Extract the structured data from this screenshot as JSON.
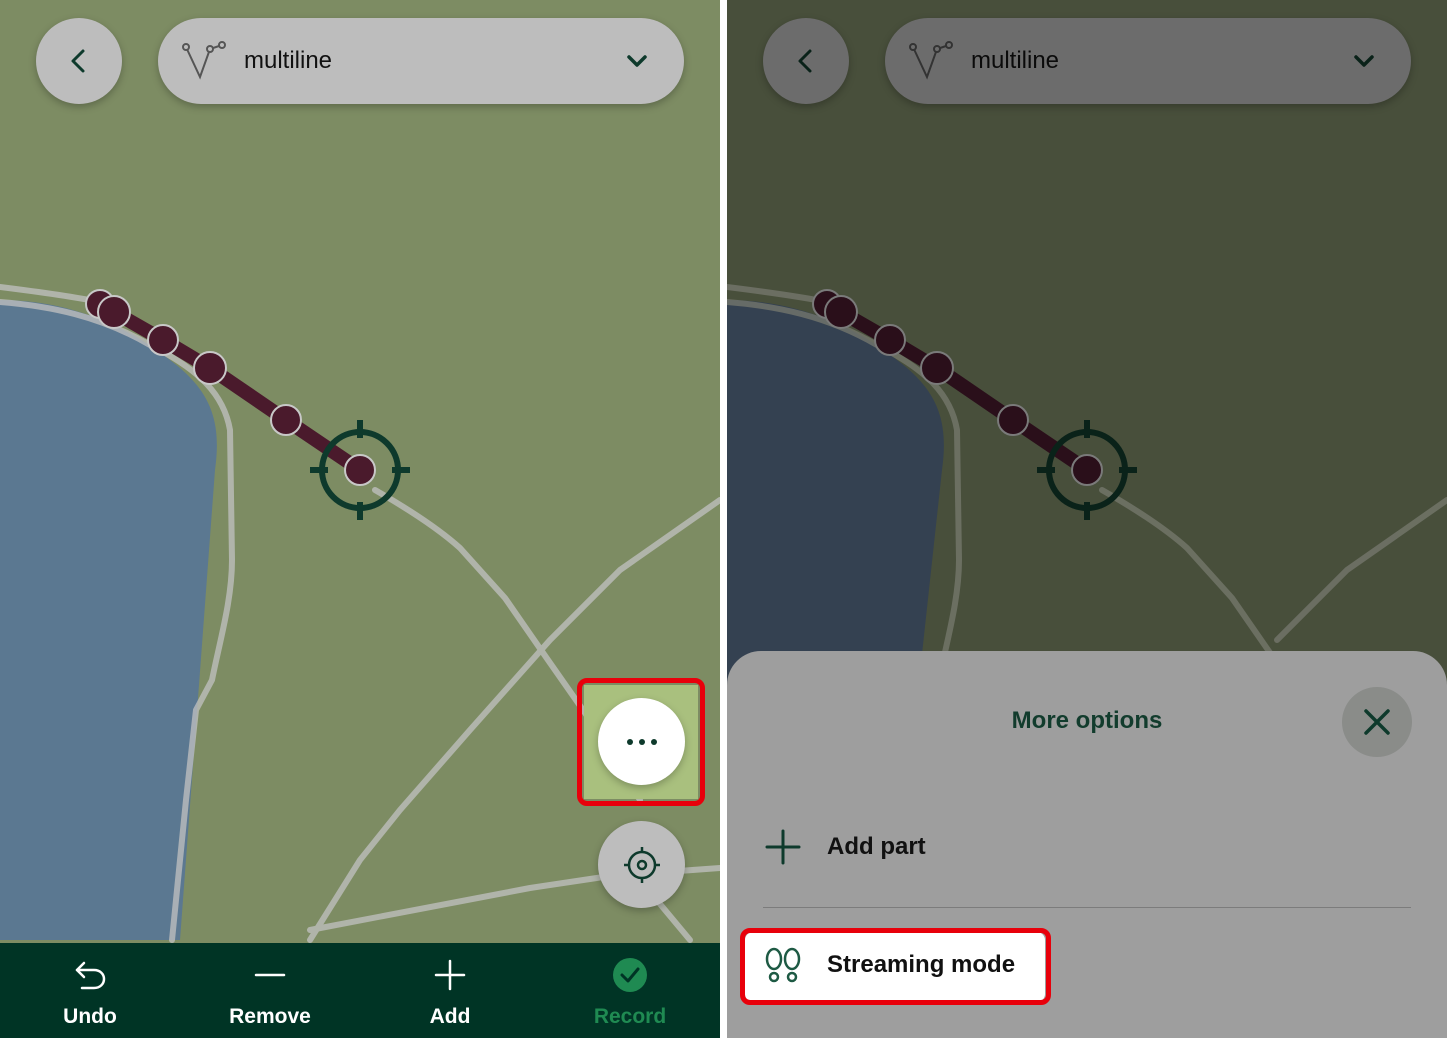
{
  "colors": {
    "map_green": "#7d8c63",
    "water": "#5b7891",
    "path_dark": "#4a1a2c",
    "toolbar_bg": "#003425",
    "accent_green": "#1f8a52",
    "highlight_red": "#e8000b"
  },
  "left_screen": {
    "header": {
      "back_icon": "chevron-left-icon",
      "layer_icon": "multiline-icon",
      "layer_name": "multiline",
      "dropdown_icon": "chevron-down-icon"
    },
    "fab_more_icon": "ellipsis-icon",
    "fab_gps_icon": "gps-target-icon",
    "toolbar": {
      "undo": "Undo",
      "remove": "Remove",
      "add": "Add",
      "record": "Record"
    }
  },
  "right_screen": {
    "header": {
      "layer_name": "multiline"
    },
    "sheet": {
      "title": "More options",
      "close_icon": "close-icon",
      "items": [
        {
          "label": "Add part",
          "icon": "plus-icon"
        },
        {
          "label": "Streaming mode",
          "icon": "footsteps-icon"
        }
      ]
    }
  }
}
